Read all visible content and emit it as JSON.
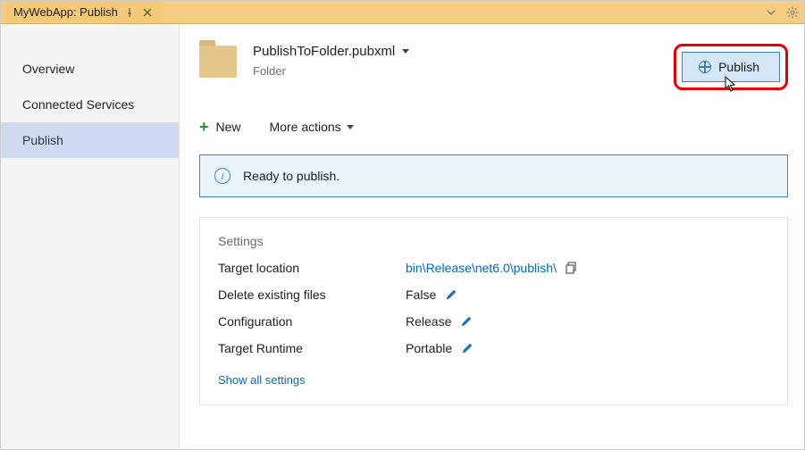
{
  "tab": {
    "title": "MyWebApp: Publish"
  },
  "sidebar": {
    "items": [
      {
        "label": "Overview",
        "selected": false
      },
      {
        "label": "Connected Services",
        "selected": false
      },
      {
        "label": "Publish",
        "selected": true
      }
    ]
  },
  "profile": {
    "name": "PublishToFolder.pubxml",
    "type": "Folder"
  },
  "publish_button": {
    "label": "Publish"
  },
  "toolbar": {
    "new_label": "New",
    "more_actions_label": "More actions"
  },
  "status": {
    "text": "Ready to publish."
  },
  "settings": {
    "heading": "Settings",
    "rows": [
      {
        "label": "Target location",
        "value": "bin\\Release\\net6.0\\publish\\",
        "link": true,
        "copy": true,
        "edit": false
      },
      {
        "label": "Delete existing files",
        "value": "False",
        "link": false,
        "copy": false,
        "edit": true
      },
      {
        "label": "Configuration",
        "value": "Release",
        "link": false,
        "copy": false,
        "edit": true
      },
      {
        "label": "Target Runtime",
        "value": "Portable",
        "link": false,
        "copy": false,
        "edit": true
      }
    ],
    "show_all_label": "Show all settings"
  }
}
